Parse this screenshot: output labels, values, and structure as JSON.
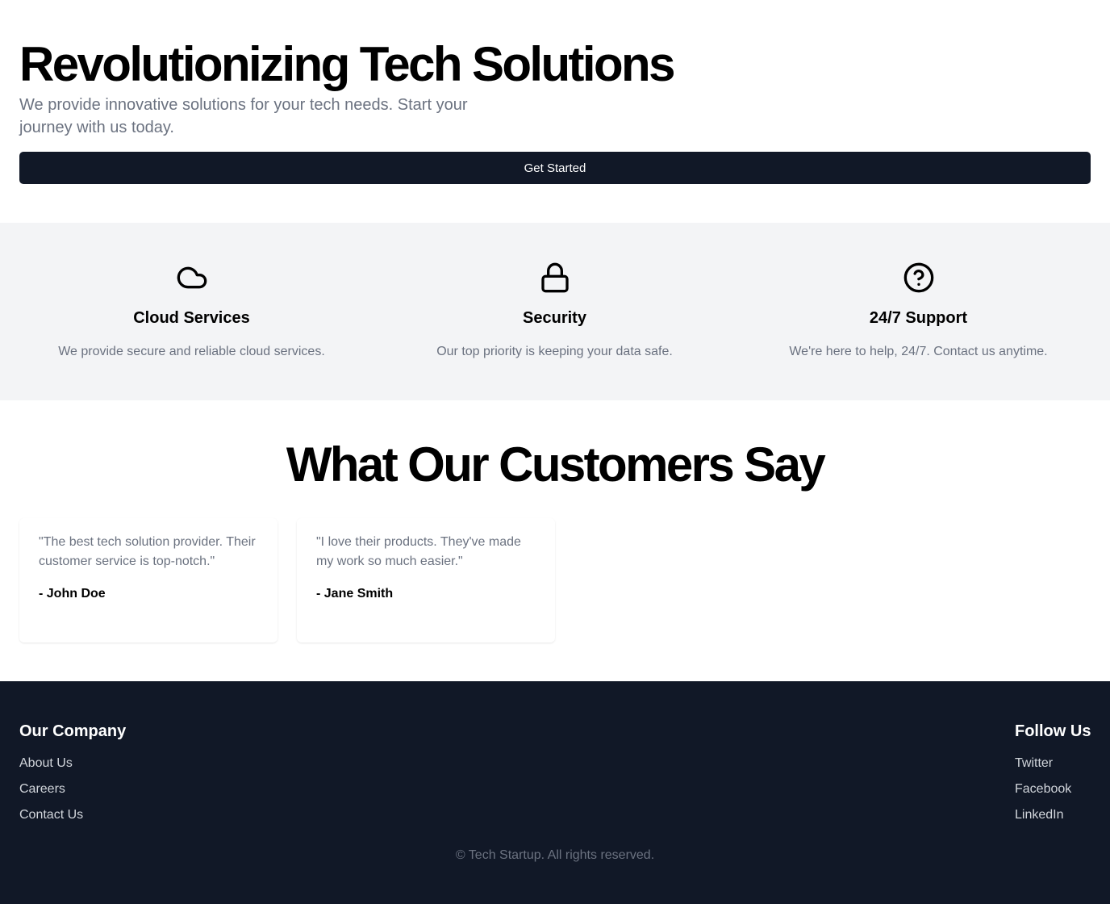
{
  "hero": {
    "title": "Revolutionizing Tech Solutions",
    "subtitle": "We provide innovative solutions for your tech needs. Start your journey with us today.",
    "cta_label": "Get Started"
  },
  "features": [
    {
      "icon": "cloud-icon",
      "title": "Cloud Services",
      "description": "We provide secure and reliable cloud services."
    },
    {
      "icon": "lock-icon",
      "title": "Security",
      "description": "Our top priority is keeping your data safe."
    },
    {
      "icon": "help-circle-icon",
      "title": "24/7 Support",
      "description": "We're here to help, 24/7. Contact us anytime."
    }
  ],
  "testimonials": {
    "title": "What Our Customers Say",
    "items": [
      {
        "quote": "\"The best tech solution provider. Their customer service is top-notch.\"",
        "author": "- John Doe"
      },
      {
        "quote": "\"I love their products. They've made my work so much easier.\"",
        "author": "- Jane Smith"
      }
    ]
  },
  "footer": {
    "company": {
      "heading": "Our Company",
      "links": [
        "About Us",
        "Careers",
        "Contact Us"
      ]
    },
    "social": {
      "heading": "Follow Us",
      "links": [
        "Twitter",
        "Facebook",
        "LinkedIn"
      ]
    },
    "copyright": "© Tech Startup. All rights reserved."
  },
  "colors": {
    "primary_dark": "#111827",
    "muted_text": "#6b7280",
    "section_bg": "#f3f4f6",
    "footer_link": "#d1d5db"
  }
}
